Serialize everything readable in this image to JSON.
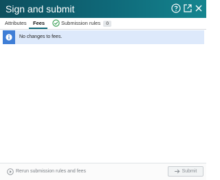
{
  "dialog": {
    "title": "Sign and submit",
    "icons": [
      "help-icon",
      "open-external-icon",
      "close-icon"
    ]
  },
  "tabs": [
    {
      "label": "Attributes",
      "active": false
    },
    {
      "label": "Fees",
      "active": true
    },
    {
      "label": "Submission rules",
      "active": false,
      "badge": "0",
      "icon": "check-circle-icon"
    }
  ],
  "banner": {
    "icon": "info-icon",
    "message": "No changes to fees."
  },
  "footer": {
    "rerun_label": "Rerun submission rules and fees",
    "rerun_icon": "play-circle-icon",
    "submit_label": "Submit",
    "submit_icon": "arrow-right-icon"
  },
  "colors": {
    "titlebar": "#0f6a7a",
    "info_blue": "#3f7ed6",
    "banner_bg": "#dde9fb",
    "check_green": "#2e9a4a"
  }
}
